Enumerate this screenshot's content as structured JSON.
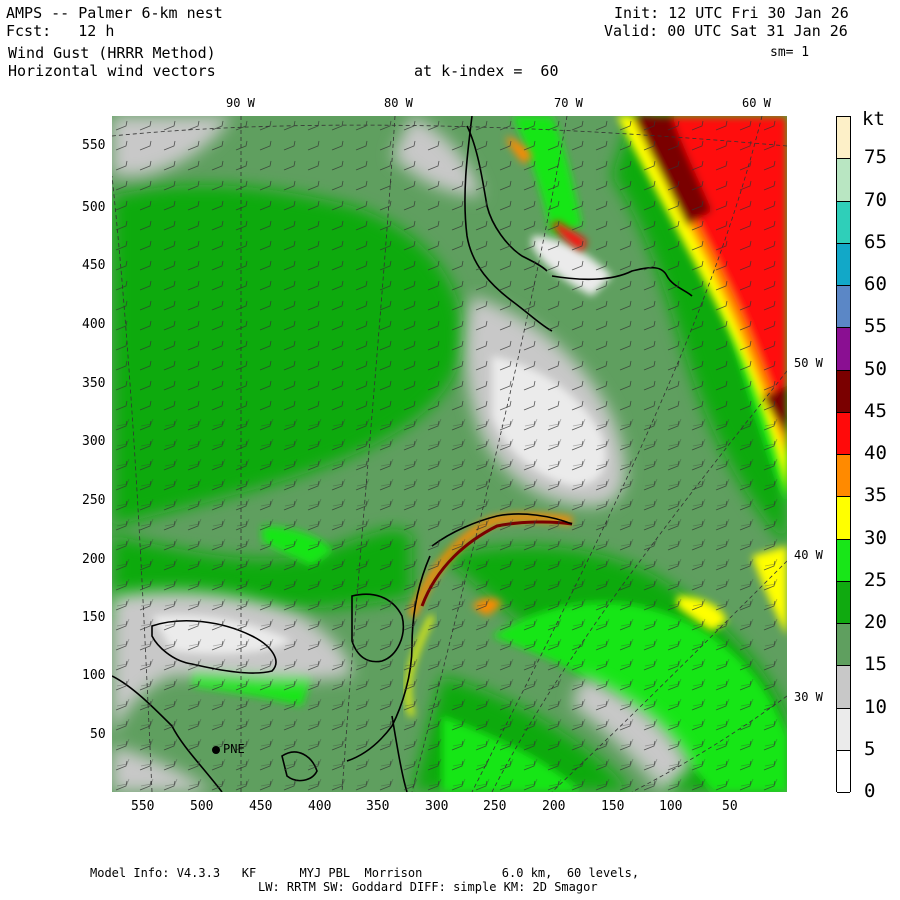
{
  "header": {
    "title": "AMPS -- Palmer 6-km nest",
    "forecast": "Fcst:   12 h",
    "field": "Wind Gust (HRRR Method)",
    "vectors": "Horizontal wind vectors",
    "init": "Init: 12 UTC Fri 30 Jan 26",
    "valid": "Valid: 00 UTC Sat 31 Jan 26",
    "level": "at k-index =  60",
    "smoothing": "sm= 1"
  },
  "axes": {
    "y_ticks": [
      "550",
      "500",
      "450",
      "400",
      "350",
      "300",
      "250",
      "200",
      "150",
      "100",
      "50"
    ],
    "x_ticks": [
      "550",
      "500",
      "450",
      "400",
      "350",
      "300",
      "250",
      "200",
      "150",
      "100",
      "50"
    ],
    "top_longitudes": [
      "90 W",
      "80 W",
      "70 W",
      "60 W"
    ],
    "right_longitudes": [
      "50 W",
      "40 W",
      "30 W"
    ]
  },
  "station": {
    "label": "PNE"
  },
  "colorbar": {
    "unit": "kt",
    "labels": [
      "75",
      "70",
      "65",
      "60",
      "55",
      "50",
      "45",
      "40",
      "35",
      "30",
      "25",
      "20",
      "15",
      "10",
      "5",
      "0"
    ],
    "colors": [
      "#fdf0c8",
      "#b9e6c2",
      "#2fcfb9",
      "#12a8c8",
      "#5b87c6",
      "#8a0f92",
      "#7a0000",
      "#ff0a0a",
      "#ff8a00",
      "#ffff00",
      "#18e618",
      "#10aa10",
      "#5f9f5f",
      "#c8c8c8",
      "#ebebeb",
      "#ffffff"
    ]
  },
  "footer": {
    "line1": "Model Info: V4.3.3   KF      MYJ PBL  Morrison           6.0 km,  60 levels,",
    "line2": "LW: RRTM SW: Goddard DIFF: simple KM: 2D Smagor"
  }
}
